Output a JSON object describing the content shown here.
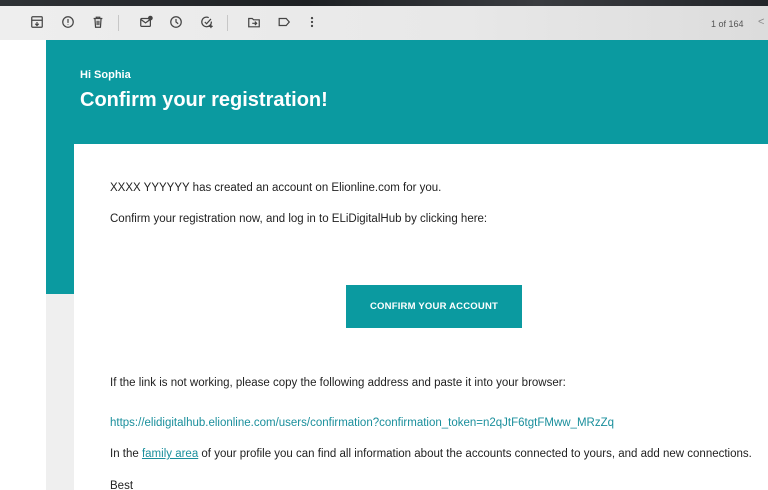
{
  "toolbar": {
    "icons": [
      "archive-icon",
      "report-spam-icon",
      "delete-icon",
      "mark-unread-icon",
      "snooze-icon",
      "add-task-icon",
      "move-to-icon",
      "label-icon",
      "more-icon"
    ],
    "count": "1 of 164",
    "prev_glyph": "<"
  },
  "email": {
    "greeting": "Hi Sophia",
    "headline": "Confirm your registration!",
    "line1": "XXXX YYYYYY has created an account on Elionline.com for you.",
    "line2": "Confirm your registration now, and log in to ELiDigitalHub by clicking here:",
    "button_label": "CONFIRM YOUR ACCOUNT",
    "line3": "If the link is not working, please copy the following address and paste it into your browser:",
    "confirm_url": "https://elidigitalhub.elionline.com/users/confirmation?confirmation_token=n2qJtF6tgtFMww_MRzZq",
    "line5_prefix": "In the ",
    "family_link": "family area",
    "line5_suffix": " of your profile you can find all information about the accounts connected to yours, and add new connections.",
    "line6": "Best"
  },
  "colors": {
    "accent": "#0b9aa0",
    "link": "#1a8f9c"
  }
}
